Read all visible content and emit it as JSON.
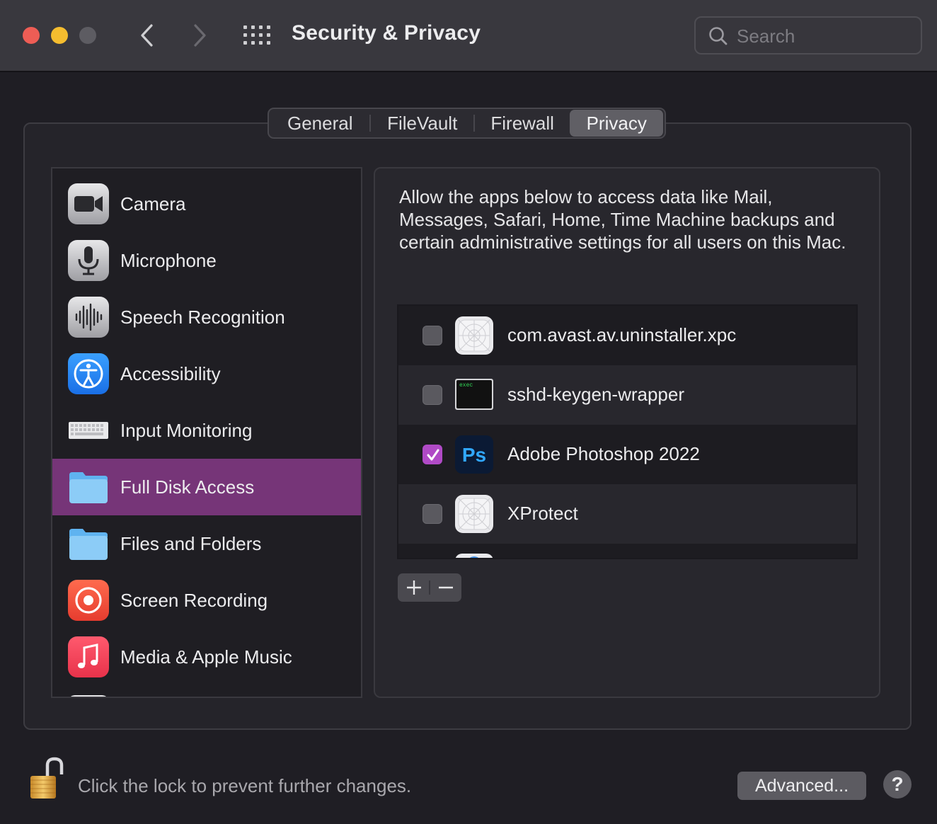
{
  "window": {
    "title": "Security & Privacy",
    "search_placeholder": "Search"
  },
  "tabs": [
    {
      "label": "General",
      "selected": false
    },
    {
      "label": "FileVault",
      "selected": false
    },
    {
      "label": "Firewall",
      "selected": false
    },
    {
      "label": "Privacy",
      "selected": true
    }
  ],
  "sidebar": {
    "items": [
      {
        "label": "Camera",
        "icon": "camera-icon"
      },
      {
        "label": "Microphone",
        "icon": "microphone-icon"
      },
      {
        "label": "Speech Recognition",
        "icon": "waveform-icon"
      },
      {
        "label": "Accessibility",
        "icon": "accessibility-icon"
      },
      {
        "label": "Input Monitoring",
        "icon": "keyboard-icon"
      },
      {
        "label": "Full Disk Access",
        "icon": "folder-icon",
        "selected": true
      },
      {
        "label": "Files and Folders",
        "icon": "folder-icon"
      },
      {
        "label": "Screen Recording",
        "icon": "record-icon"
      },
      {
        "label": "Media & Apple Music",
        "icon": "music-icon"
      }
    ]
  },
  "panel": {
    "description": "Allow the apps below to access data like Mail, Messages, Safari, Home, Time Machine backups and certain administrative settings for all users on this Mac.",
    "apps": [
      {
        "label": "com.avast.av.uninstaller.xpc",
        "checked": false,
        "icon": "generic-app-icon"
      },
      {
        "label": "sshd-keygen-wrapper",
        "checked": false,
        "icon": "terminal-exec-icon",
        "icon_text": "exec"
      },
      {
        "label": "Adobe Photoshop 2022",
        "checked": true,
        "icon": "photoshop-icon",
        "icon_text": "Ps"
      },
      {
        "label": "XProtect",
        "checked": false,
        "icon": "generic-app-icon"
      }
    ],
    "add_label": "+",
    "remove_label": "−"
  },
  "footer": {
    "lock_text": "Click the lock to prevent further changes.",
    "advanced_label": "Advanced...",
    "help_label": "?"
  },
  "colors": {
    "selection": "#763578",
    "checkbox_on": "#b04ac6",
    "close": "#ee5d55",
    "minimize": "#f5bd2f"
  }
}
